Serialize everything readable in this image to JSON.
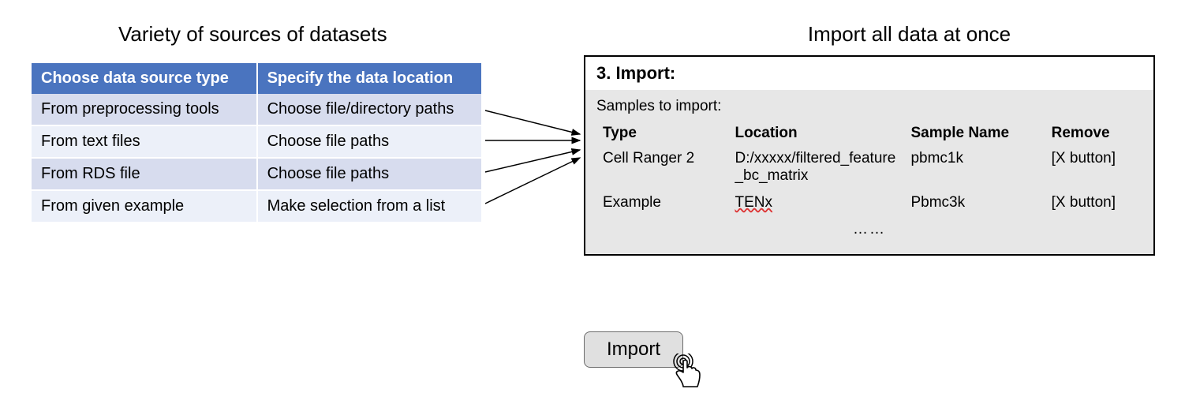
{
  "left_title": "Variety of sources of datasets",
  "right_title": "Import all data at once",
  "source_table": {
    "headers": [
      "Choose data source type",
      "Specify the data location"
    ],
    "rows": [
      [
        "From preprocessing tools",
        "Choose file/directory paths"
      ],
      [
        "From text files",
        "Choose file paths"
      ],
      [
        "From RDS file",
        "Choose file paths"
      ],
      [
        "From given example",
        "Make selection from a list"
      ]
    ]
  },
  "import_panel": {
    "title": "3. Import:",
    "subtitle": "Samples to import:",
    "columns": [
      "Type",
      "Location",
      "Sample Name",
      "Remove"
    ],
    "rows": [
      {
        "type": "Cell Ranger 2",
        "location": "D:/xxxxx/filtered_feature_bc_matrix",
        "sample": "pbmc1k",
        "remove": "[X button]"
      },
      {
        "type": "Example",
        "location": "TENx",
        "sample": "Pbmc3k",
        "remove": "[X button]"
      }
    ],
    "ellipsis": "……"
  },
  "import_button_label": "Import"
}
